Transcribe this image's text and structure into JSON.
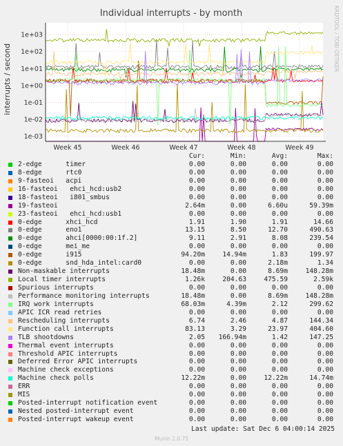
{
  "chart_data": {
    "type": "line",
    "title": "Individual interrupts - by month",
    "ylabel": "interrupts / second",
    "yscale": "log",
    "ylim": [
      0.0005,
      5000
    ],
    "yticks": [
      "1e-03",
      "1e-02",
      "1e-01",
      "1e+00",
      "1e+01",
      "1e+02",
      "1e+03"
    ],
    "x_categories": [
      "Week 45",
      "Week 46",
      "Week 47",
      "Week 48",
      "Week 49"
    ],
    "side_label": "RRDTOOL / TOBI OETIKER",
    "columns": [
      "Cur:",
      "Min:",
      "Avg:",
      "Max:"
    ],
    "series": [
      {
        "name": "2-edge      timer",
        "color": "#00cc00",
        "cur": "0.00",
        "min": "0.00",
        "avg": "0.00",
        "max": "0.00"
      },
      {
        "name": "8-edge      rtc0",
        "color": "#0066b3",
        "cur": "0.00",
        "min": "0.00",
        "avg": "0.00",
        "max": "0.00"
      },
      {
        "name": "9-fasteoi   acpi",
        "color": "#ff8000",
        "cur": "0.00",
        "min": "0.00",
        "avg": "0.00",
        "max": "0.00"
      },
      {
        "name": "16-fasteoi   ehci_hcd:usb2",
        "color": "#ffcc00",
        "cur": "0.00",
        "min": "0.00",
        "avg": "0.00",
        "max": "0.00"
      },
      {
        "name": "18-fasteoi   i801_smbus",
        "color": "#330099",
        "cur": "0.00",
        "min": "0.00",
        "avg": "0.00",
        "max": "0.00"
      },
      {
        "name": "19-fasteoi",
        "color": "#990099",
        "cur": "2.64m",
        "min": "0.00",
        "avg": "6.60u",
        "max": "59.39m"
      },
      {
        "name": "23-fasteoi   ehci_hcd:usb1",
        "color": "#ccff00",
        "cur": "0.00",
        "min": "0.00",
        "avg": "0.00",
        "max": "0.00"
      },
      {
        "name": "0-edge      xhci_hcd",
        "color": "#ff0000",
        "cur": "1.91",
        "min": "1.90",
        "avg": "1.91",
        "max": "14.66"
      },
      {
        "name": "0-edge      eno1",
        "color": "#808080",
        "cur": "13.15",
        "min": "8.50",
        "avg": "12.70",
        "max": "490.63"
      },
      {
        "name": "0-edge      ahci[0000:00:1f.2]",
        "color": "#008f00",
        "cur": "9.11",
        "min": "2.91",
        "avg": "8.08",
        "max": "239.54"
      },
      {
        "name": "0-edge      mei_me",
        "color": "#00487d",
        "cur": "0.00",
        "min": "0.00",
        "avg": "0.00",
        "max": "0.00"
      },
      {
        "name": "0-edge      i915",
        "color": "#b35a00",
        "cur": "94.20m",
        "min": "14.94m",
        "avg": "1.83",
        "max": "199.97"
      },
      {
        "name": "0-edge      snd_hda_intel:card0",
        "color": "#b38f00",
        "cur": "0.00",
        "min": "0.00",
        "avg": "2.18m",
        "max": "1.34"
      },
      {
        "name": "Non-maskable interrupts",
        "color": "#6b006b",
        "cur": "18.48m",
        "min": "0.00",
        "avg": "8.69m",
        "max": "148.28m"
      },
      {
        "name": "Local timer interrupts",
        "color": "#8fb300",
        "cur": "1.26k",
        "min": "204.63",
        "avg": "475.59",
        "max": "2.59k"
      },
      {
        "name": "Spurious interrupts",
        "color": "#b30000",
        "cur": "0.00",
        "min": "0.00",
        "avg": "0.00",
        "max": "0.00"
      },
      {
        "name": "Performance monitoring interrupts",
        "color": "#bebebe",
        "cur": "18.48m",
        "min": "0.00",
        "avg": "8.69m",
        "max": "148.28m"
      },
      {
        "name": "IRQ work interrupts",
        "color": "#80ff80",
        "cur": "68.03m",
        "min": "4.39m",
        "avg": "2.12",
        "max": "299.62"
      },
      {
        "name": "APIC ICR read retries",
        "color": "#80c9ff",
        "cur": "0.00",
        "min": "0.00",
        "avg": "0.00",
        "max": "0.00"
      },
      {
        "name": "Rescheduling interrupts",
        "color": "#ffc080",
        "cur": "6.74",
        "min": "2.46",
        "avg": "4.87",
        "max": "144.34"
      },
      {
        "name": "Function call interrupts",
        "color": "#ffe680",
        "cur": "83.13",
        "min": "3.29",
        "avg": "23.97",
        "max": "404.60"
      },
      {
        "name": "TLB shootdowns",
        "color": "#aa80ff",
        "cur": "2.05",
        "min": "166.94m",
        "avg": "1.42",
        "max": "147.25"
      },
      {
        "name": "Thermal event interrupts",
        "color": "#ee00cc",
        "cur": "0.00",
        "min": "0.00",
        "avg": "0.00",
        "max": "0.00"
      },
      {
        "name": "Threshold APIC interrupts",
        "color": "#ff8080",
        "cur": "0.00",
        "min": "0.00",
        "avg": "0.00",
        "max": "0.00"
      },
      {
        "name": "Deferred Error APIC interrupts",
        "color": "#666600",
        "cur": "0.00",
        "min": "0.00",
        "avg": "0.00",
        "max": "0.00"
      },
      {
        "name": "Machine check exceptions",
        "color": "#ffbfff",
        "cur": "0.00",
        "min": "0.00",
        "avg": "0.00",
        "max": "0.00"
      },
      {
        "name": "Machine check polls",
        "color": "#00ffcc",
        "cur": "12.22m",
        "min": "0.00",
        "avg": "12.22m",
        "max": "14.74m"
      },
      {
        "name": "ERR",
        "color": "#cc6699",
        "cur": "0.00",
        "min": "0.00",
        "avg": "0.00",
        "max": "0.00"
      },
      {
        "name": "MIS",
        "color": "#999900",
        "cur": "0.00",
        "min": "0.00",
        "avg": "0.00",
        "max": "0.00"
      },
      {
        "name": "Posted-interrupt notification event",
        "color": "#00cc00",
        "cur": "0.00",
        "min": "0.00",
        "avg": "0.00",
        "max": "0.00"
      },
      {
        "name": "Nested posted-interrupt event",
        "color": "#0066b3",
        "cur": "0.00",
        "min": "0.00",
        "avg": "0.00",
        "max": "0.00"
      },
      {
        "name": "Posted-interrupt wakeup event",
        "color": "#ff8000",
        "cur": "0.00",
        "min": "0.00",
        "avg": "0.00",
        "max": "0.00"
      }
    ]
  },
  "footer": {
    "last_update": "Last update: Sat Dec  6 04:00:14 2025",
    "version": "Munin 2.0.75"
  }
}
